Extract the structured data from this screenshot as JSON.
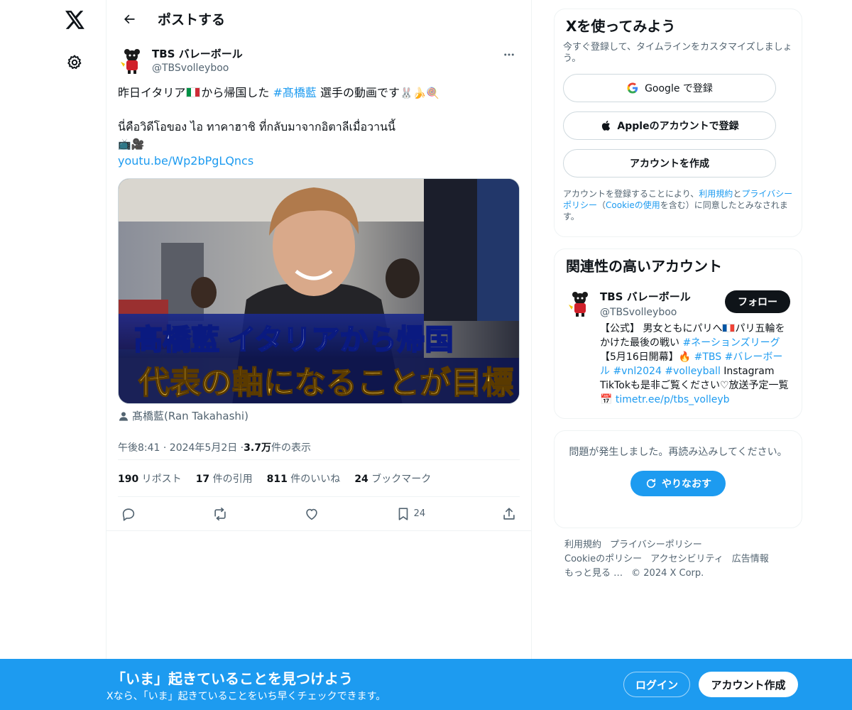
{
  "main": {
    "title": "ポストする"
  },
  "post": {
    "author_name": "TBS バレーボール",
    "author_handle": "@TBSvolleyboo",
    "text_line1_pre": "昨日イタリア",
    "text_line1_mid": "から帰国した ",
    "hashtag": "#髙橋藍",
    "text_line1_post": " 選手の動画です",
    "text_line1_emoji": "🐰🍌🍭",
    "text_line2": "นี่คือวิดีโอของ ไอ ทาคาฮาชิ ที่กลับมาจากอิตาลีเมื่อวานนี้",
    "text_line3_emoji": "📺🎥",
    "link": "youtu.be/Wp2bPgLQncs",
    "media_caption_line1": "髙橋藍 イタリアから帰国",
    "media_caption_line2": "代表の軸になることが目標",
    "media_credit": "髙橋藍(Ran Takahashi)",
    "time": "午後8:41 · 2024年5月2日 · ",
    "views_value": "3.7万",
    "views_label": " 件の表示",
    "counts": {
      "reposts_value": "190",
      "reposts_label": " リポスト",
      "quotes_value": "17",
      "quotes_label": " 件の引用",
      "likes_value": "811",
      "likes_label": " 件のいいね",
      "bookmarks_value": "24",
      "bookmarks_label": " ブックマーク"
    },
    "bookmark_count": "24"
  },
  "signup": {
    "title": "Xを使ってみよう",
    "subtitle": "今すぐ登録して、タイムラインをカスタマイズしましょう。",
    "google_label": "Google で登録",
    "apple_label": "Appleのアカウントで登録",
    "create_label": "アカウントを作成",
    "terms_pre": "アカウントを登録することにより、",
    "terms_link1": "利用規約",
    "terms_and": "と",
    "terms_link2": "プライバシーポリシー",
    "terms_mid": "（",
    "terms_link3": "Cookieの使用",
    "terms_post": "を含む）に同意したとみなされます。"
  },
  "related": {
    "title": "関連性の高いアカウント",
    "name": "TBS バレーボール",
    "handle": "@TBSvolleyboo",
    "follow_label": "フォロー",
    "bio_1": "【公式】 男女ともにパリへ",
    "bio_2": "パリ五輪をかけた最後の戦い ",
    "bio_tag1": "#ネーションズリーグ",
    "bio_3": " 【5月16日開幕】🔥 ",
    "bio_tag2": "#TBS",
    "bio_tag3": "#バレーボール",
    "bio_tag4": "#vnl2024",
    "bio_tag5": "#volleyball",
    "bio_4": " Instagram TikTokも是非ご覧ください♡放送予定一覧📅 ",
    "bio_link": "timetr.ee/p/tbs_volleyb"
  },
  "error": {
    "message": "問題が発生しました。再読み込みしてください。",
    "retry_label": "やりなおす"
  },
  "footer": {
    "links": [
      "利用規約",
      "プライバシーポリシー",
      "Cookieのポリシー",
      "アクセシビリティ",
      "広告情報",
      "もっと見る …"
    ],
    "copyright": "© 2024 X Corp."
  },
  "bottombar": {
    "title": "「いま」起きていることを見つけよう",
    "subtitle": "Xなら、「いま」起きていることをいち早くチェックできます。",
    "login_label": "ログイン",
    "create_label": "アカウント作成"
  },
  "colors": {
    "accent": "#1d9bf0",
    "text": "#0f1419",
    "secondary": "#536471"
  }
}
